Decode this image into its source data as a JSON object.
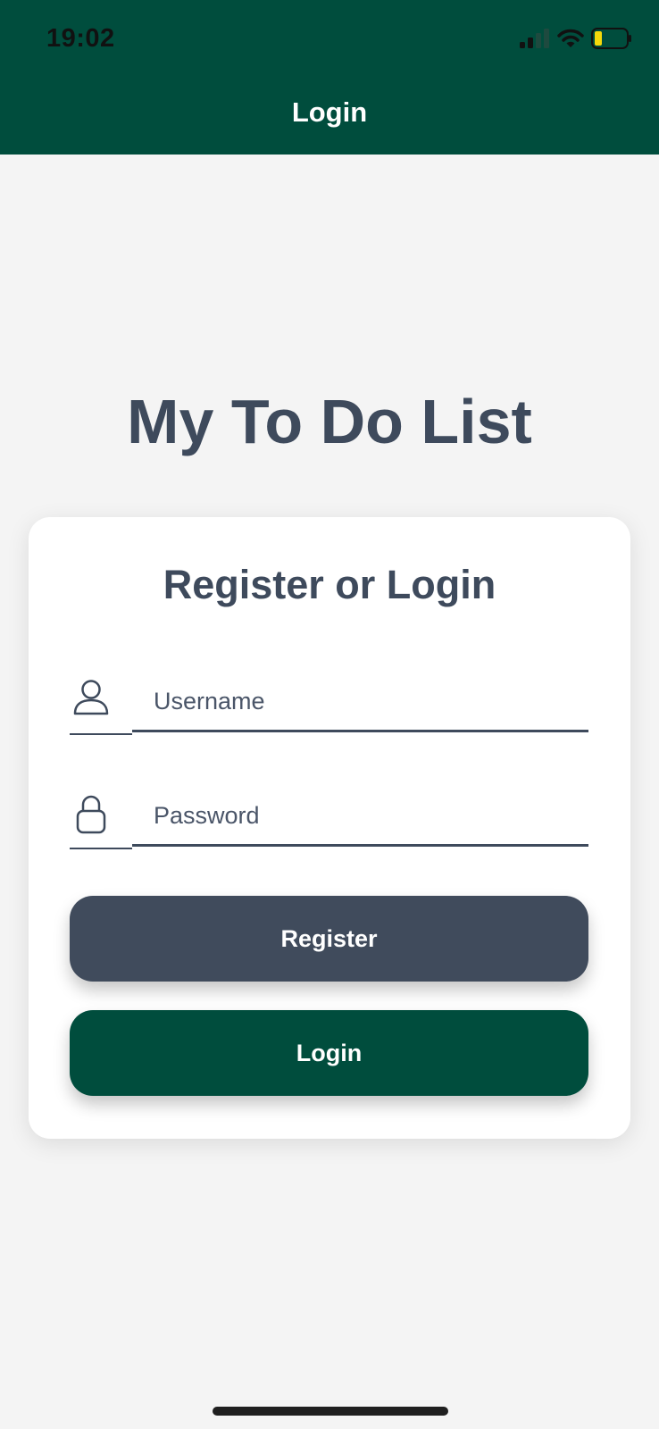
{
  "status_bar": {
    "time": "19:02",
    "signal_icon": "cellular-signal-icon",
    "wifi_icon": "wifi-icon",
    "battery_icon": "battery-low-icon",
    "battery_color": "#f5d90a"
  },
  "header": {
    "title": "Login",
    "background_color": "#004d3d"
  },
  "app_title": "My To Do List",
  "card": {
    "title": "Register or Login",
    "username": {
      "icon": "user-icon",
      "placeholder": "Username",
      "value": ""
    },
    "password": {
      "icon": "lock-icon",
      "placeholder": "Password",
      "value": ""
    },
    "register_button": {
      "label": "Register",
      "color": "#404b5c"
    },
    "login_button": {
      "label": "Login",
      "color": "#004d3d"
    }
  },
  "colors": {
    "background": "#f4f4f4",
    "text_primary": "#3e4a5c"
  }
}
